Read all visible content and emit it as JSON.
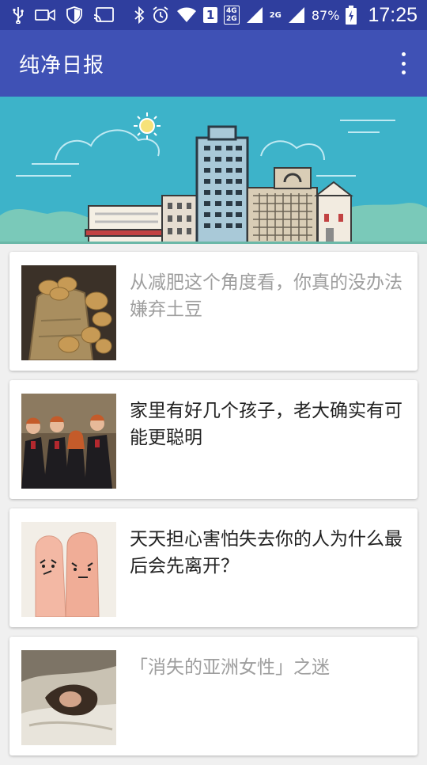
{
  "status_bar": {
    "battery": "87%",
    "time": "17:25",
    "sim": "1",
    "net_top": "4G",
    "net_bottom": "2G",
    "net2": "2G",
    "icons": [
      "usb-icon",
      "video-icon",
      "shield-icon",
      "cast-icon",
      "bluetooth-icon",
      "alarm-icon",
      "wifi-icon",
      "signal-icon",
      "battery-icon"
    ]
  },
  "app": {
    "title": "纯净日报"
  },
  "colors": {
    "status_bar": "#2f3e9e",
    "toolbar": "#3f51b5",
    "banner_sky": "#3db3c9",
    "title_unread": "#222222",
    "title_read": "#9e9e9e"
  },
  "articles": [
    {
      "title": "从减肥这个角度看，你真的没办法嫌弃土豆",
      "read": true,
      "thumb": "potato-sack-image"
    },
    {
      "title": "家里有好几个孩子，老大确实有可能更聪明",
      "read": false,
      "thumb": "group-photo-image"
    },
    {
      "title": "天天担心害怕失去你的人为什么最后会先离开？",
      "read": false,
      "thumb": "finger-faces-image"
    },
    {
      "title": "「消失的亚洲女性」之迷",
      "read": true,
      "thumb": "sleeping-woman-image"
    }
  ]
}
